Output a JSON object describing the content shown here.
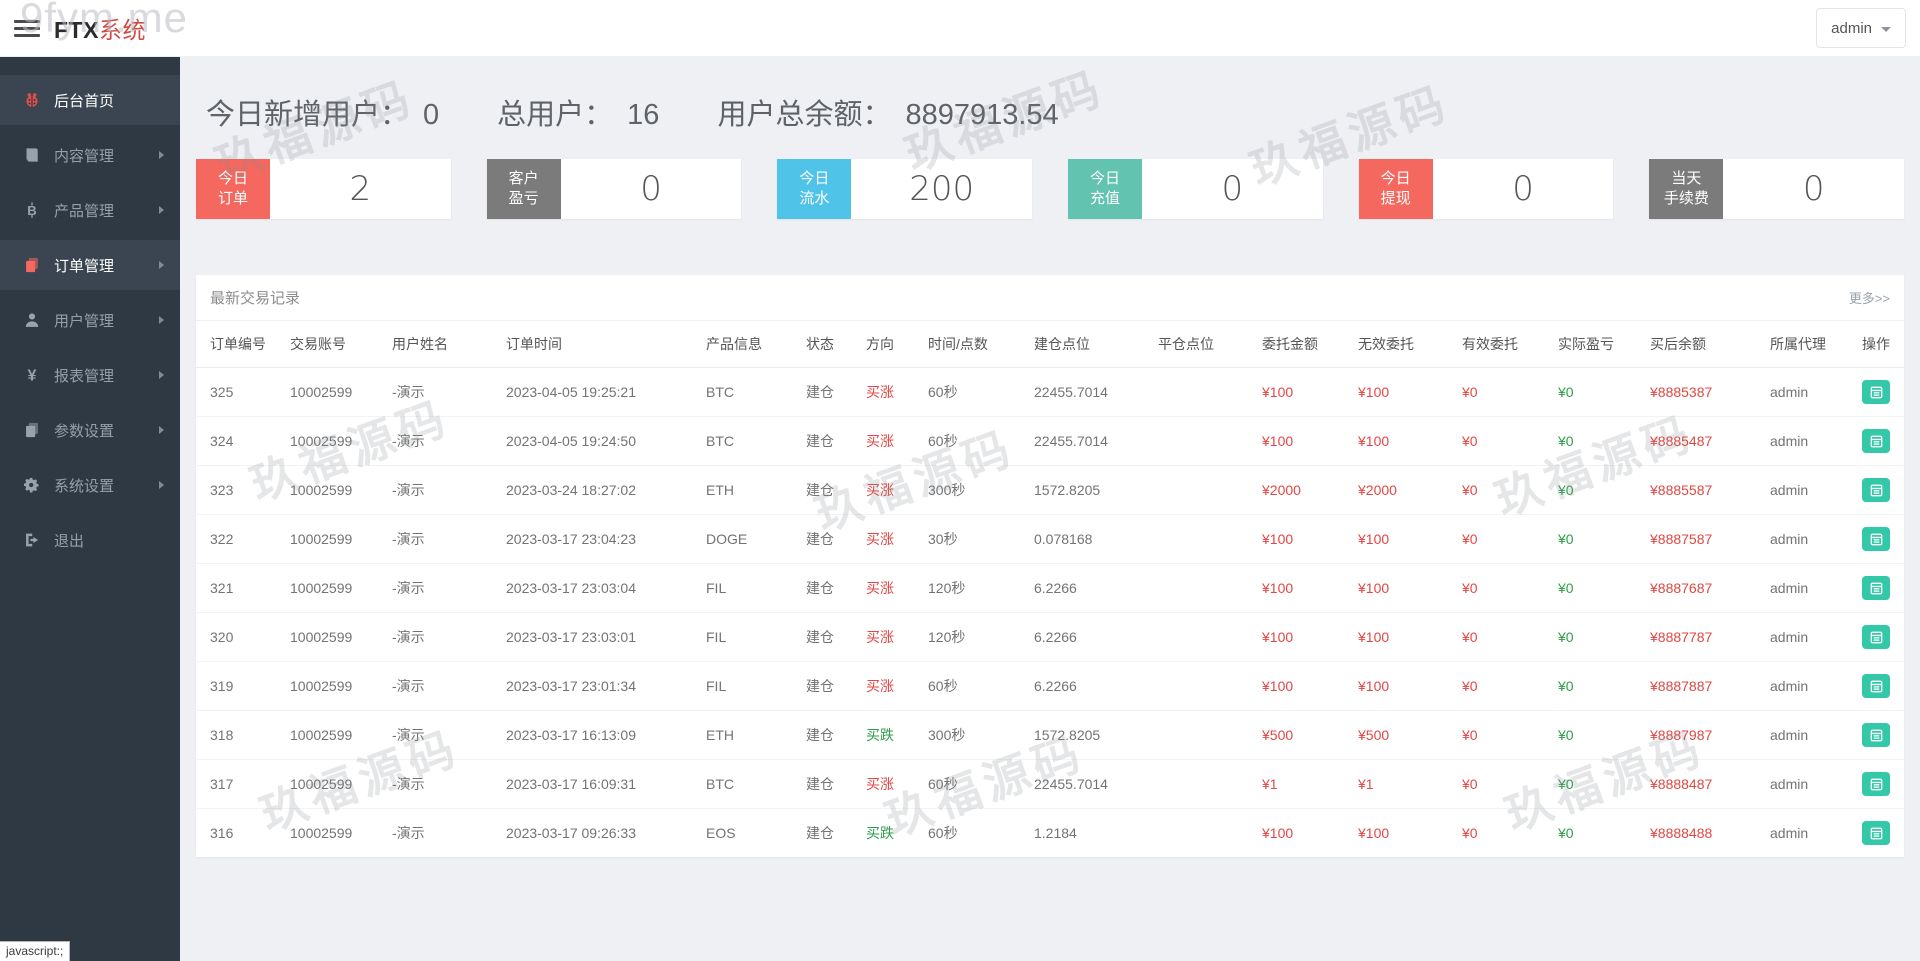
{
  "header": {
    "title_primary": "FTX",
    "title_accent": "系统",
    "user_menu_label": "admin"
  },
  "watermarks": {
    "corner": "9fym.me",
    "brand": "玖福源码"
  },
  "sidebar": {
    "items": [
      {
        "key": "home",
        "label": "后台首页",
        "icon": "dashboard-bug-icon",
        "icon_color": "#e0514a",
        "active": true,
        "arrow": false
      },
      {
        "key": "content",
        "label": "内容管理",
        "icon": "book-icon",
        "icon_color": "#99a2aa",
        "active": false,
        "arrow": true
      },
      {
        "key": "product",
        "label": "产品管理",
        "icon": "bitcoin-icon",
        "icon_color": "#99a2aa",
        "active": false,
        "arrow": true
      },
      {
        "key": "orders",
        "label": "订单管理",
        "icon": "orders-copy-icon",
        "icon_color": "#f4685f",
        "active": true,
        "arrow": true
      },
      {
        "key": "users",
        "label": "用户管理",
        "icon": "user-icon",
        "icon_color": "#99a2aa",
        "active": false,
        "arrow": true
      },
      {
        "key": "reports",
        "label": "报表管理",
        "icon": "yen-icon",
        "icon_color": "#99a2aa",
        "active": false,
        "arrow": true
      },
      {
        "key": "params",
        "label": "参数设置",
        "icon": "params-copy-icon",
        "icon_color": "#99a2aa",
        "active": false,
        "arrow": true
      },
      {
        "key": "system",
        "label": "系统设置",
        "icon": "gear-icon",
        "icon_color": "#99a2aa",
        "active": false,
        "arrow": true
      },
      {
        "key": "logout",
        "label": "退出",
        "icon": "logout-icon",
        "icon_color": "#99a2aa",
        "active": false,
        "arrow": false
      }
    ]
  },
  "overview": {
    "new_users_label": "今日新增用户：",
    "new_users_value": "0",
    "total_users_label": "总用户：",
    "total_users_value": "16",
    "total_balance_label": "用户总余额：",
    "total_balance_value": "8897913.54"
  },
  "stat_cards": [
    {
      "label_lines": [
        "今日",
        "订单"
      ],
      "value": "2",
      "color": "#f4685f"
    },
    {
      "label_lines": [
        "客户",
        "盈亏"
      ],
      "value": "0",
      "color": "#7b7b7b"
    },
    {
      "label_lines": [
        "今日",
        "流水"
      ],
      "value": "200",
      "color": "#4fc3e8"
    },
    {
      "label_lines": [
        "今日",
        "充值"
      ],
      "value": "0",
      "color": "#61c3b0"
    },
    {
      "label_lines": [
        "今日",
        "提现"
      ],
      "value": "0",
      "color": "#f4685f"
    },
    {
      "label_lines": [
        "当天",
        "手续费"
      ],
      "value": "0",
      "color": "#7b7b7b"
    }
  ],
  "table": {
    "title": "最新交易记录",
    "more_link": "更多>>",
    "columns": [
      "订单编号",
      "交易账号",
      "用户姓名",
      "订单时间",
      "产品信息",
      "状态",
      "方向",
      "时间/点数",
      "建仓点位",
      "平仓点位",
      "委托金额",
      "无效委托",
      "有效委托",
      "实际盈亏",
      "买后余额",
      "所属代理",
      "操作"
    ],
    "rows": [
      {
        "id": "325",
        "account": "10002599",
        "name": "-演示",
        "time": "2023-04-05 19:25:21",
        "product": "BTC",
        "status": "建仓",
        "direction": "买涨",
        "direction_type": "up",
        "duration": "60秒",
        "open_point": "22455.7014",
        "close_point": "",
        "amount": "¥100",
        "invalid": "¥100",
        "valid": "¥0",
        "profit": "¥0",
        "balance": "¥8885387",
        "agent": "admin"
      },
      {
        "id": "324",
        "account": "10002599",
        "name": "-演示",
        "time": "2023-04-05 19:24:50",
        "product": "BTC",
        "status": "建仓",
        "direction": "买涨",
        "direction_type": "up",
        "duration": "60秒",
        "open_point": "22455.7014",
        "close_point": "",
        "amount": "¥100",
        "invalid": "¥100",
        "valid": "¥0",
        "profit": "¥0",
        "balance": "¥8885487",
        "agent": "admin"
      },
      {
        "id": "323",
        "account": "10002599",
        "name": "-演示",
        "time": "2023-03-24 18:27:02",
        "product": "ETH",
        "status": "建仓",
        "direction": "买涨",
        "direction_type": "up",
        "duration": "300秒",
        "open_point": "1572.8205",
        "close_point": "",
        "amount": "¥2000",
        "invalid": "¥2000",
        "valid": "¥0",
        "profit": "¥0",
        "balance": "¥8885587",
        "agent": "admin"
      },
      {
        "id": "322",
        "account": "10002599",
        "name": "-演示",
        "time": "2023-03-17 23:04:23",
        "product": "DOGE",
        "status": "建仓",
        "direction": "买涨",
        "direction_type": "up",
        "duration": "30秒",
        "open_point": "0.078168",
        "close_point": "",
        "amount": "¥100",
        "invalid": "¥100",
        "valid": "¥0",
        "profit": "¥0",
        "balance": "¥8887587",
        "agent": "admin"
      },
      {
        "id": "321",
        "account": "10002599",
        "name": "-演示",
        "time": "2023-03-17 23:03:04",
        "product": "FIL",
        "status": "建仓",
        "direction": "买涨",
        "direction_type": "up",
        "duration": "120秒",
        "open_point": "6.2266",
        "close_point": "",
        "amount": "¥100",
        "invalid": "¥100",
        "valid": "¥0",
        "profit": "¥0",
        "balance": "¥8887687",
        "agent": "admin"
      },
      {
        "id": "320",
        "account": "10002599",
        "name": "-演示",
        "time": "2023-03-17 23:03:01",
        "product": "FIL",
        "status": "建仓",
        "direction": "买涨",
        "direction_type": "up",
        "duration": "120秒",
        "open_point": "6.2266",
        "close_point": "",
        "amount": "¥100",
        "invalid": "¥100",
        "valid": "¥0",
        "profit": "¥0",
        "balance": "¥8887787",
        "agent": "admin"
      },
      {
        "id": "319",
        "account": "10002599",
        "name": "-演示",
        "time": "2023-03-17 23:01:34",
        "product": "FIL",
        "status": "建仓",
        "direction": "买涨",
        "direction_type": "up",
        "duration": "60秒",
        "open_point": "6.2266",
        "close_point": "",
        "amount": "¥100",
        "invalid": "¥100",
        "valid": "¥0",
        "profit": "¥0",
        "balance": "¥8887887",
        "agent": "admin"
      },
      {
        "id": "318",
        "account": "10002599",
        "name": "-演示",
        "time": "2023-03-17 16:13:09",
        "product": "ETH",
        "status": "建仓",
        "direction": "买跌",
        "direction_type": "down",
        "duration": "300秒",
        "open_point": "1572.8205",
        "close_point": "",
        "amount": "¥500",
        "invalid": "¥500",
        "valid": "¥0",
        "profit": "¥0",
        "balance": "¥8887987",
        "agent": "admin"
      },
      {
        "id": "317",
        "account": "10002599",
        "name": "-演示",
        "time": "2023-03-17 16:09:31",
        "product": "BTC",
        "status": "建仓",
        "direction": "买涨",
        "direction_type": "up",
        "duration": "60秒",
        "open_point": "22455.7014",
        "close_point": "",
        "amount": "¥1",
        "invalid": "¥1",
        "valid": "¥0",
        "profit": "¥0",
        "balance": "¥8888487",
        "agent": "admin"
      },
      {
        "id": "316",
        "account": "10002599",
        "name": "-演示",
        "time": "2023-03-17 09:26:33",
        "product": "EOS",
        "status": "建仓",
        "direction": "买跌",
        "direction_type": "down",
        "duration": "60秒",
        "open_point": "1.2184",
        "close_point": "",
        "amount": "¥100",
        "invalid": "¥100",
        "valid": "¥0",
        "profit": "¥0",
        "balance": "¥8888488",
        "agent": "admin"
      }
    ]
  },
  "colors": {
    "accent_red": "#cf4a43",
    "direction_up": "#e14743",
    "direction_down": "#2e9e48",
    "op_button": "#33c9a8",
    "sidebar_bg": "#2e3944"
  },
  "statusbar": {
    "text": "javascript:;"
  }
}
